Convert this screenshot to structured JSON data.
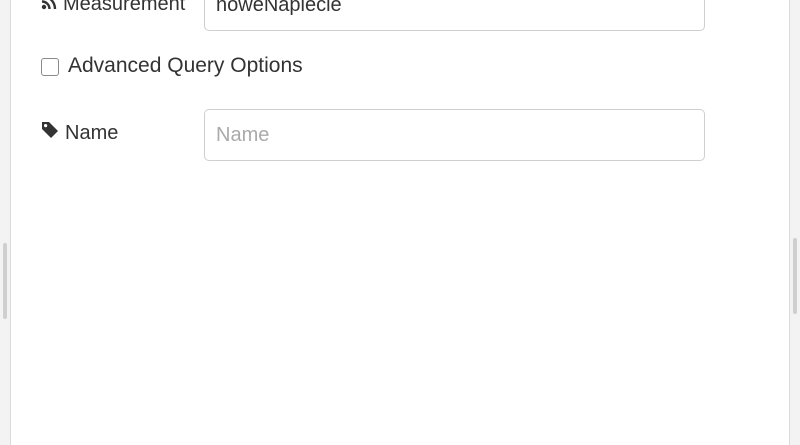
{
  "form": {
    "measurement": {
      "label": "Measurement",
      "icon": "rss-icon",
      "value": "noweNapiecie"
    },
    "advanced_options": {
      "label": "Advanced Query Options",
      "checked": false
    },
    "name": {
      "label": "Name",
      "icon": "tag-icon",
      "value": "",
      "placeholder": "Name"
    }
  }
}
